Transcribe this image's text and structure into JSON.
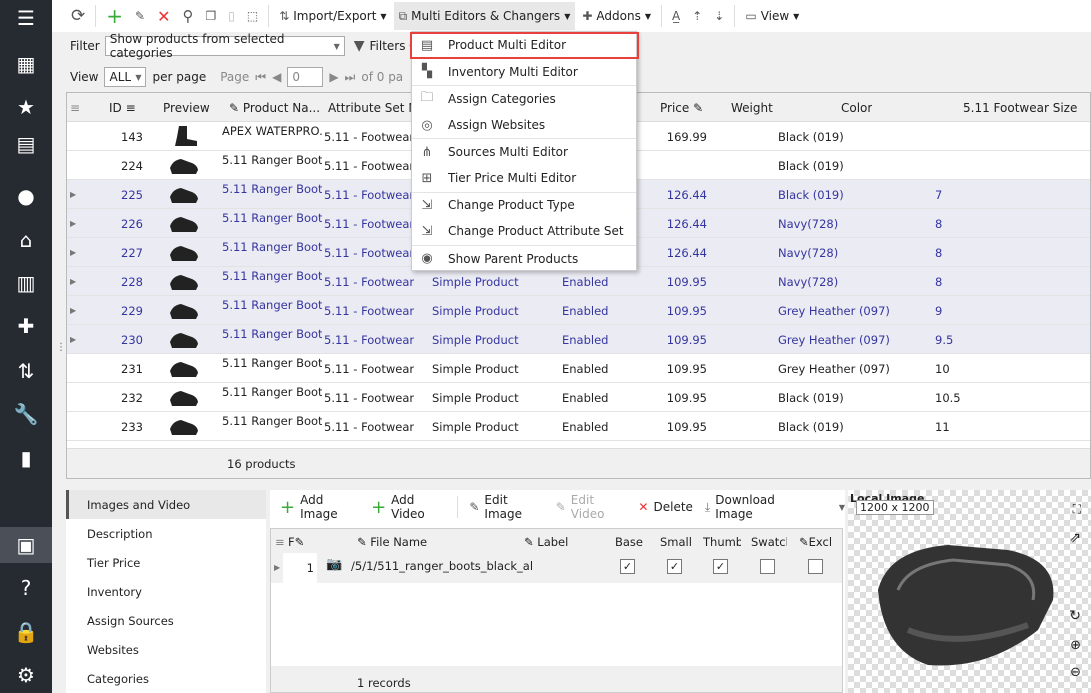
{
  "sidebar": {
    "items": [
      "menu-icon",
      "store-icon",
      "star-icon",
      "archive-icon",
      "user-icon",
      "home-icon",
      "chart-icon",
      "puzzle-icon",
      "sort-icon",
      "wrench-icon",
      "layout-icon",
      "box-icon",
      "help-icon",
      "lock-icon",
      "gear-icon"
    ]
  },
  "toolbar": {
    "import_export": "Import/Export",
    "multi_editors": "Multi Editors & Changers",
    "addons": "Addons",
    "view": "View"
  },
  "filter": {
    "label": "Filter",
    "value": "Show products from selected categories",
    "filters": "Filters"
  },
  "paging": {
    "view_label": "View",
    "view_value": "ALL",
    "per_page": "per page",
    "page_label": "Page",
    "page_value": "0",
    "of_pages": "of 0 pa"
  },
  "grid": {
    "columns": [
      "ID",
      "Preview",
      "Product Na...",
      "Attribute Set Na",
      "Price",
      "Weight",
      "Color",
      "5.11 Footwear Size"
    ],
    "rows": [
      {
        "id": "143",
        "name": "APEX WATERPRO...",
        "set": "5.11 - Footwear",
        "type": "",
        "status": "",
        "price": "169.99",
        "color": "Black (019)",
        "size": "",
        "hl": false
      },
      {
        "id": "224",
        "name": "5.11 Ranger Boot...",
        "set": "5.11 - Footwear",
        "type": "",
        "status": "",
        "price": "",
        "color": "Black (019)",
        "size": "",
        "hl": false
      },
      {
        "id": "225",
        "name": "5.11 Ranger Boot...",
        "set": "5.11 - Footwear",
        "type": "",
        "status": "",
        "price": "126.44",
        "color": "Black (019)",
        "size": "7",
        "hl": true
      },
      {
        "id": "226",
        "name": "5.11 Ranger Boot...",
        "set": "5.11 - Footwear",
        "type": "",
        "status": "",
        "price": "126.44",
        "color": "Navy(728)",
        "size": "8",
        "hl": true
      },
      {
        "id": "227",
        "name": "5.11 Ranger Boot...",
        "set": "5.11 - Footwear",
        "type": "",
        "status": "",
        "price": "126.44",
        "color": "Navy(728)",
        "size": "8",
        "hl": true
      },
      {
        "id": "228",
        "name": "5.11 Ranger Boot...",
        "set": "5.11 - Footwear",
        "type": "Simple Product",
        "status": "Enabled",
        "price": "109.95",
        "color": "Navy(728)",
        "size": "8",
        "hl": true
      },
      {
        "id": "229",
        "name": "5.11 Ranger Boot...",
        "set": "5.11 - Footwear",
        "type": "Simple Product",
        "status": "Enabled",
        "price": "109.95",
        "color": "Grey Heather (097)",
        "size": "9",
        "hl": true
      },
      {
        "id": "230",
        "name": "5.11 Ranger Boot...",
        "set": "5.11 - Footwear",
        "type": "Simple Product",
        "status": "Enabled",
        "price": "109.95",
        "color": "Grey Heather (097)",
        "size": "9.5",
        "hl": true
      },
      {
        "id": "231",
        "name": "5.11 Ranger Boot...",
        "set": "5.11 - Footwear",
        "type": "Simple Product",
        "status": "Enabled",
        "price": "109.95",
        "color": "Grey Heather (097)",
        "size": "10",
        "hl": false
      },
      {
        "id": "232",
        "name": "5.11 Ranger Boot...",
        "set": "5.11 - Footwear",
        "type": "Simple Product",
        "status": "Enabled",
        "price": "109.95",
        "color": "Black (019)",
        "size": "10.5",
        "hl": false
      },
      {
        "id": "233",
        "name": "5.11 Ranger Boot...",
        "set": "5.11 - Footwear",
        "type": "Simple Product",
        "status": "Enabled",
        "price": "109.95",
        "color": "Black (019)",
        "size": "11",
        "hl": false
      }
    ],
    "footer": "16 products"
  },
  "menu": {
    "items": [
      "Product Multi Editor",
      "Inventory Multi Editor",
      "Assign Categories",
      "Assign Websites",
      "Sources Multi Editor",
      "Tier Price Multi Editor",
      "Change Product Type",
      "Change Product Attribute Set",
      "Show Parent Products"
    ]
  },
  "tabs": [
    "Images and Video",
    "Description",
    "Tier Price",
    "Inventory",
    "Assign Sources",
    "Websites",
    "Categories"
  ],
  "images": {
    "toolbar": [
      "Add Image",
      "Add Video",
      "Edit Image",
      "Edit Video",
      "Delete",
      "Download Image"
    ],
    "columns": [
      "F",
      "File Name",
      "Label",
      "Base",
      "Small",
      "Thumb",
      "Swatch",
      "Excl"
    ],
    "row": {
      "pos": "1",
      "file": "/5/1/511_ranger_boots_black_al",
      "base": true,
      "small": true,
      "thumb": true,
      "swatch": false,
      "excl": false
    },
    "footer": "1 records"
  },
  "preview": {
    "title": "Local Image",
    "size": "1200 x 1200"
  },
  "colors": {
    "sidebar": "#262a31",
    "highlight_text": "#3535a0",
    "menu_highlight": "#e8413c"
  }
}
